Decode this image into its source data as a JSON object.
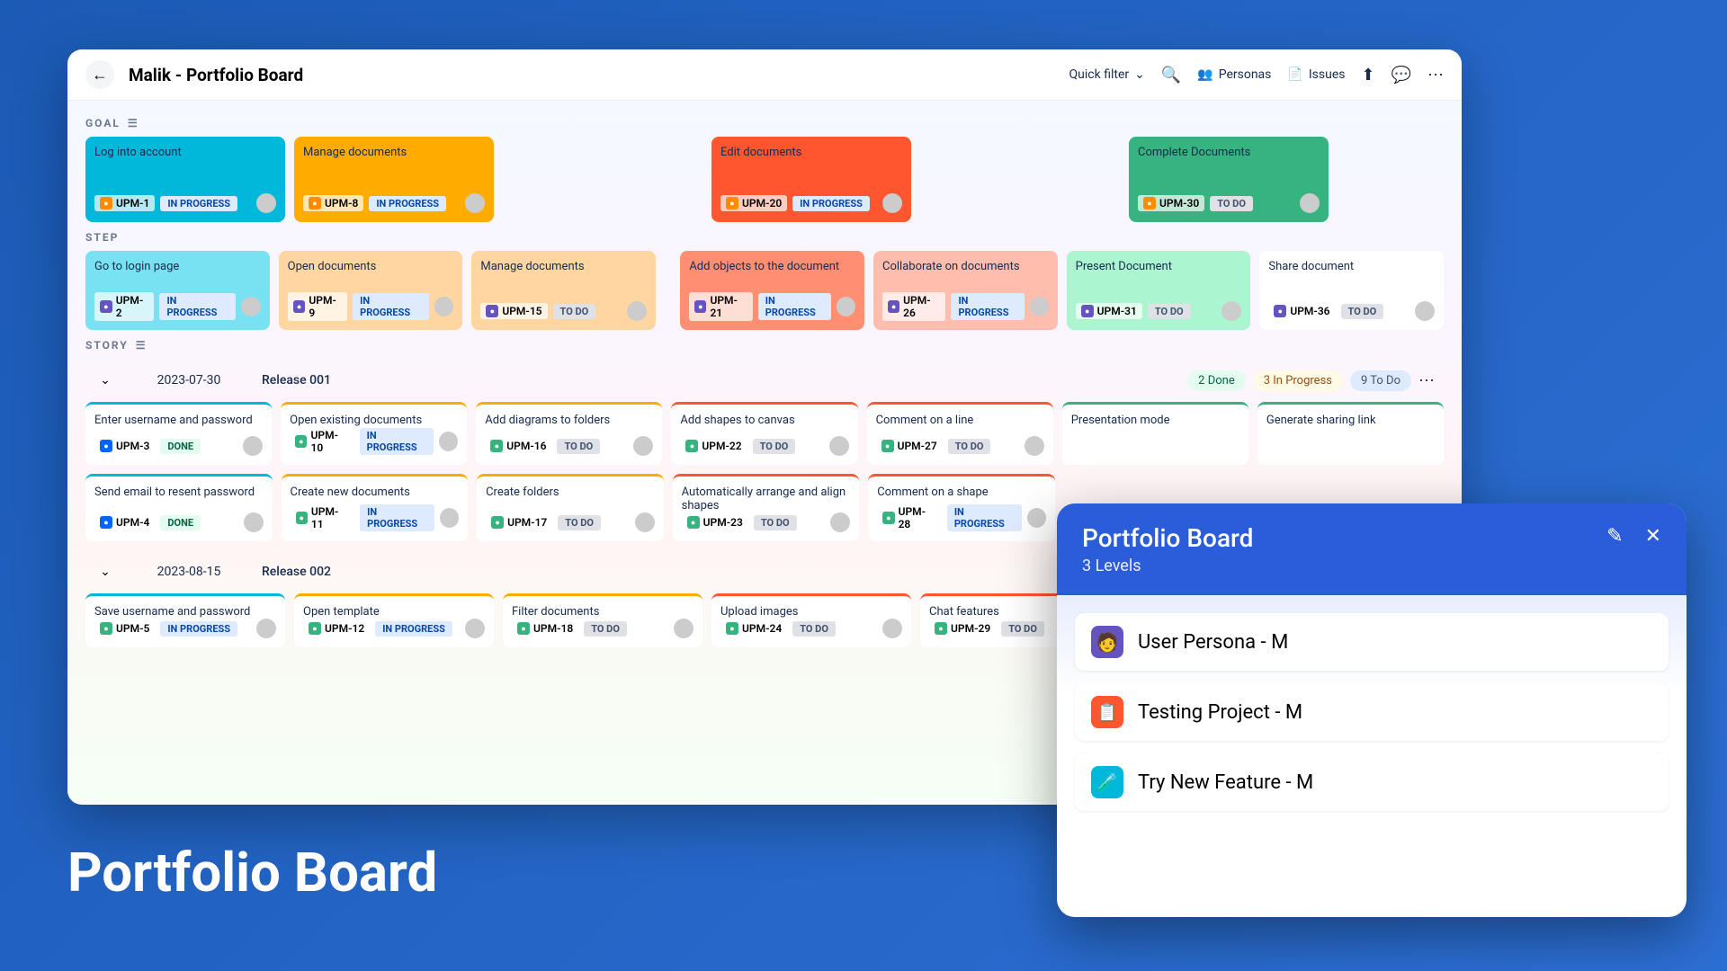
{
  "header": {
    "title": "Malik - Portfolio Board",
    "quick_filter": "Quick filter",
    "personas": "Personas",
    "issues": "Issues"
  },
  "labels": {
    "goal": "GOAL",
    "step": "STEP",
    "story": "STORY"
  },
  "goals": [
    {
      "title": "Log into account",
      "key": "UPM-1",
      "status": "IN PROGRESS",
      "bg": "#00b8d9"
    },
    {
      "title": "Manage documents",
      "key": "UPM-8",
      "status": "IN PROGRESS",
      "bg": "#ffab00"
    },
    {
      "title": "Edit documents",
      "key": "UPM-20",
      "status": "IN PROGRESS",
      "bg": "#ff5630"
    },
    {
      "title": "Complete Documents",
      "key": "UPM-30",
      "status": "TO DO",
      "bg": "#36b37e"
    }
  ],
  "steps": [
    {
      "title": "Go to login page",
      "key": "UPM-2",
      "status": "IN PROGRESS",
      "bg": "#79e2f2"
    },
    {
      "title": "Open documents",
      "key": "UPM-9",
      "status": "IN PROGRESS",
      "bg": "#ffd6a1"
    },
    {
      "title": "Manage documents",
      "key": "UPM-15",
      "status": "TO DO",
      "bg": "#ffd6a1"
    },
    {
      "title": "Add objects to the document",
      "key": "UPM-21",
      "status": "IN PROGRESS",
      "bg": "#ff8f73"
    },
    {
      "title": "Collaborate on documents",
      "key": "UPM-26",
      "status": "IN PROGRESS",
      "bg": "#ffbdad"
    },
    {
      "title": "Present Document",
      "key": "UPM-31",
      "status": "TO DO",
      "bg": "#abf5d1"
    },
    {
      "title": "Share document",
      "key": "UPM-36",
      "status": "TO DO",
      "bg": "#ffffff"
    }
  ],
  "releases": [
    {
      "date": "2023-07-30",
      "name": "Release 001",
      "done": "2 Done",
      "prog": "3 In Progress",
      "todo": "9 To Do"
    },
    {
      "date": "2023-08-15",
      "name": "Release 002"
    }
  ],
  "stories1": [
    [
      {
        "title": "Enter username and password",
        "key": "UPM-3",
        "status": "DONE",
        "bc": "#00b8d9"
      },
      {
        "title": "Send email to resent password",
        "key": "UPM-4",
        "status": "DONE",
        "bc": "#00b8d9"
      }
    ],
    [
      {
        "title": "Open existing documents",
        "key": "UPM-10",
        "status": "IN PROGRESS",
        "bc": "#ffab00"
      },
      {
        "title": "Create new documents",
        "key": "UPM-11",
        "status": "IN PROGRESS",
        "bc": "#ffab00"
      }
    ],
    [
      {
        "title": "Add diagrams to folders",
        "key": "UPM-16",
        "status": "TO DO",
        "bc": "#ffab00"
      },
      {
        "title": "Create folders",
        "key": "UPM-17",
        "status": "TO DO",
        "bc": "#ffab00"
      }
    ],
    [
      {
        "title": "Add shapes to canvas",
        "key": "UPM-22",
        "status": "TO DO",
        "bc": "#ff5630"
      },
      {
        "title": "Automatically arrange and align shapes",
        "key": "UPM-23",
        "status": "TO DO",
        "bc": "#ff5630"
      }
    ],
    [
      {
        "title": "Comment on a line",
        "key": "UPM-27",
        "status": "TO DO",
        "bc": "#ff5630"
      },
      {
        "title": "Comment on a shape",
        "key": "UPM-28",
        "status": "IN PROGRESS",
        "bc": "#ff5630"
      }
    ],
    [
      {
        "title": "Presentation mode",
        "key": "",
        "status": "",
        "bc": "#36b37e"
      }
    ],
    [
      {
        "title": "Generate sharing link",
        "key": "",
        "status": "",
        "bc": "#36b37e"
      }
    ]
  ],
  "stories2": [
    {
      "title": "Save username and password",
      "key": "UPM-5",
      "status": "IN PROGRESS",
      "bc": "#00b8d9"
    },
    {
      "title": "Open template",
      "key": "UPM-12",
      "status": "IN PROGRESS",
      "bc": "#ffab00"
    },
    {
      "title": "Filter documents",
      "key": "UPM-18",
      "status": "TO DO",
      "bc": "#ffab00"
    },
    {
      "title": "Upload images",
      "key": "UPM-24",
      "status": "TO DO",
      "bc": "#ff5630"
    },
    {
      "title": "Chat features",
      "key": "UPM-29",
      "status": "TO DO",
      "bc": "#ff5630"
    }
  ],
  "panel": {
    "title": "Portfolio Board",
    "subtitle": "3 Levels",
    "items": [
      "User Persona - M",
      "Testing Project - M",
      "Try New Feature - M"
    ]
  },
  "hero": "Portfolio Board"
}
